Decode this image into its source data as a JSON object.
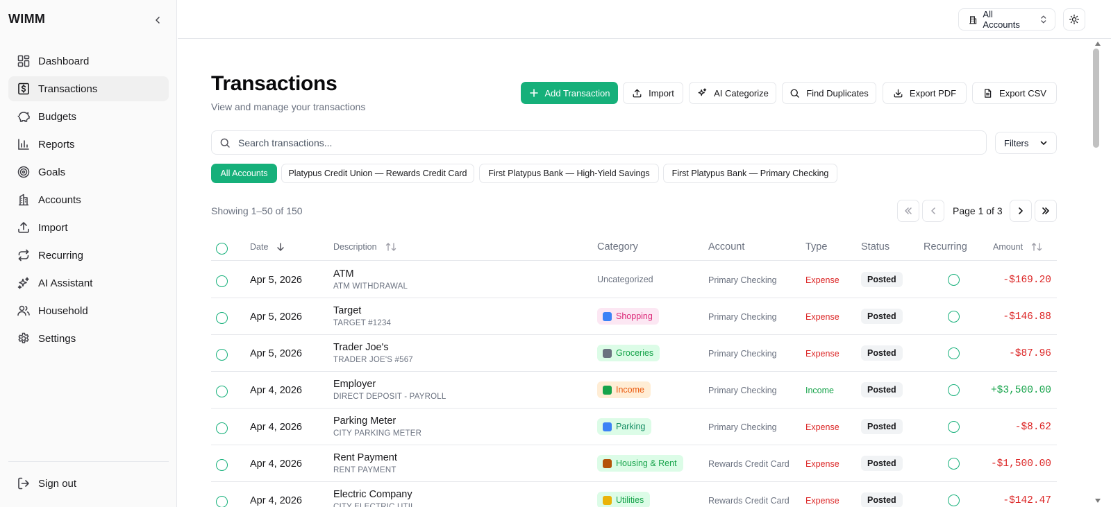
{
  "sidebar": {
    "brand": "WIMM",
    "items": [
      {
        "label": "Dashboard",
        "icon": "layout-dashboard-icon"
      },
      {
        "label": "Transactions",
        "icon": "dollar-receipt-icon",
        "active": true
      },
      {
        "label": "Budgets",
        "icon": "piggy-bank-icon"
      },
      {
        "label": "Reports",
        "icon": "bar-chart-icon"
      },
      {
        "label": "Goals",
        "icon": "target-icon"
      },
      {
        "label": "Accounts",
        "icon": "building-icon"
      },
      {
        "label": "Import",
        "icon": "upload-icon"
      },
      {
        "label": "Recurring",
        "icon": "repeat-icon"
      },
      {
        "label": "AI Assistant",
        "icon": "sparkles-icon"
      },
      {
        "label": "Household",
        "icon": "users-icon"
      },
      {
        "label": "Settings",
        "icon": "gear-icon"
      }
    ],
    "signout": "Sign out"
  },
  "topbar": {
    "account_selector": "All Accounts"
  },
  "header": {
    "title": "Transactions",
    "subtitle": "View and manage your transactions"
  },
  "actions": {
    "add": "Add Transaction",
    "import": "Import",
    "ai_categorize": "AI Categorize",
    "find_duplicates": "Find Duplicates",
    "export_pdf": "Export PDF",
    "export_csv": "Export CSV"
  },
  "search": {
    "placeholder": "Search transactions...",
    "value": ""
  },
  "filters_label": "Filters",
  "account_chips": [
    "All Accounts",
    "Platypus Credit Union — Rewards Credit Card",
    "First Platypus Bank — High-Yield Savings",
    "First Platypus Bank — Primary Checking"
  ],
  "pagination": {
    "showing": "Showing 1–50 of 150",
    "page_label": "Page 1 of 3"
  },
  "table": {
    "columns": {
      "date": "Date",
      "description": "Description",
      "category": "Category",
      "account": "Account",
      "type": "Type",
      "status": "Status",
      "recurring": "Recurring",
      "amount": "Amount"
    },
    "rows": [
      {
        "date": "Apr 5, 2026",
        "desc": "ATM",
        "sub": "ATM WITHDRAWAL",
        "category": "Uncategorized",
        "cat_style": "plain",
        "account": "Primary Checking",
        "type": "Expense",
        "status": "Posted",
        "amount": "-$169.20"
      },
      {
        "date": "Apr 5, 2026",
        "desc": "Target",
        "sub": "TARGET #1234",
        "category": "Shopping",
        "cat_style": "shopping",
        "account": "Primary Checking",
        "type": "Expense",
        "status": "Posted",
        "amount": "-$146.88"
      },
      {
        "date": "Apr 5, 2026",
        "desc": "Trader Joe's",
        "sub": "TRADER JOE'S #567",
        "category": "Groceries",
        "cat_style": "groceries",
        "account": "Primary Checking",
        "type": "Expense",
        "status": "Posted",
        "amount": "-$87.96"
      },
      {
        "date": "Apr 4, 2026",
        "desc": "Employer",
        "sub": "DIRECT DEPOSIT - PAYROLL",
        "category": "Income",
        "cat_style": "income",
        "account": "Primary Checking",
        "type": "Income",
        "status": "Posted",
        "amount": "+$3,500.00"
      },
      {
        "date": "Apr 4, 2026",
        "desc": "Parking Meter",
        "sub": "CITY PARKING METER",
        "category": "Parking",
        "cat_style": "parking",
        "account": "Primary Checking",
        "type": "Expense",
        "status": "Posted",
        "amount": "-$8.62"
      },
      {
        "date": "Apr 4, 2026",
        "desc": "Rent Payment",
        "sub": "RENT PAYMENT",
        "category": "Housing & Rent",
        "cat_style": "housing",
        "account": "Rewards Credit Card",
        "type": "Expense",
        "status": "Posted",
        "amount": "-$1,500.00"
      },
      {
        "date": "Apr 4, 2026",
        "desc": "Electric Company",
        "sub": "CITY ELECTRIC UTIL",
        "category": "Utilities",
        "cat_style": "utilities",
        "account": "Rewards Credit Card",
        "type": "Expense",
        "status": "Posted",
        "amount": "-$142.47"
      }
    ]
  },
  "colors": {
    "accent": "#16b07a",
    "expense": "#dc2626",
    "income": "#16a34a"
  }
}
